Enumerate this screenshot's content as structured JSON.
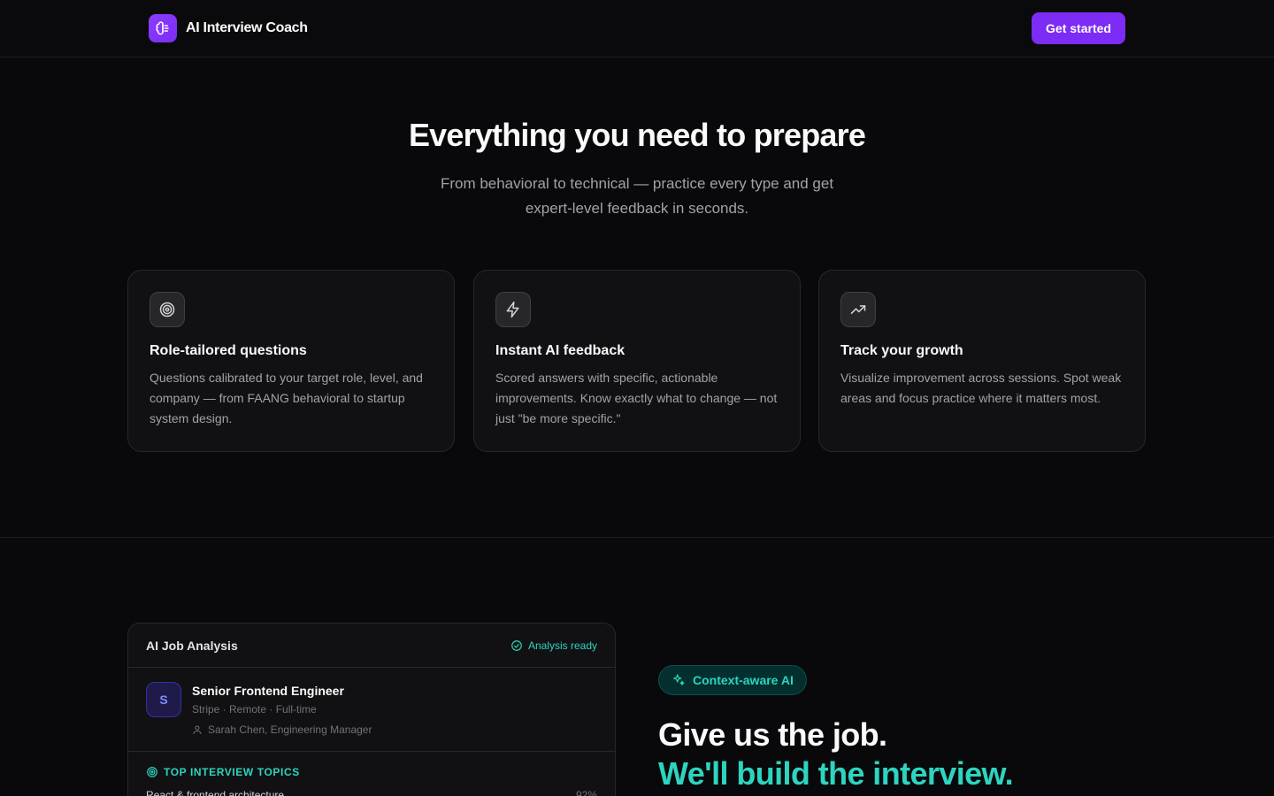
{
  "header": {
    "brand_name": "AI Interview Coach",
    "cta_label": "Get started"
  },
  "hero": {
    "title": "Everything you need to prepare",
    "subtitle": "From behavioral to technical — practice every type and get expert-level feedback in seconds."
  },
  "features": [
    {
      "icon": "target-icon",
      "title": "Role-tailored questions",
      "description": "Questions calibrated to your target role, level, and company — from FAANG behavioral to startup system design."
    },
    {
      "icon": "lightning-icon",
      "title": "Instant AI feedback",
      "description": "Scored answers with specific, actionable improvements. Know exactly what to change — not just \"be more specific.\""
    },
    {
      "icon": "trending-up-icon",
      "title": "Track your growth",
      "description": "Visualize improvement across sessions. Spot weak areas and focus practice where it matters most."
    }
  ],
  "job_panel": {
    "title": "AI Job Analysis",
    "status": "Analysis ready",
    "avatar_letter": "S",
    "job_title": "Senior Frontend Engineer",
    "job_meta": "Stripe · Remote · Full-time",
    "contact": "Sarah Chen, Engineering Manager",
    "topics_heading": "TOP INTERVIEW TOPICS",
    "topics": [
      {
        "label": "React & frontend architecture",
        "percent": "92%"
      }
    ]
  },
  "context": {
    "pill_label": "Context-aware AI",
    "heading_line1": "Give us the job.",
    "heading_line2": "We'll build the interview."
  },
  "colors": {
    "background": "#09090b",
    "brand_purple": "#7c2cf5",
    "accent_teal": "#2dd4bf",
    "card_bg": "#111113",
    "border": "#27272a"
  }
}
